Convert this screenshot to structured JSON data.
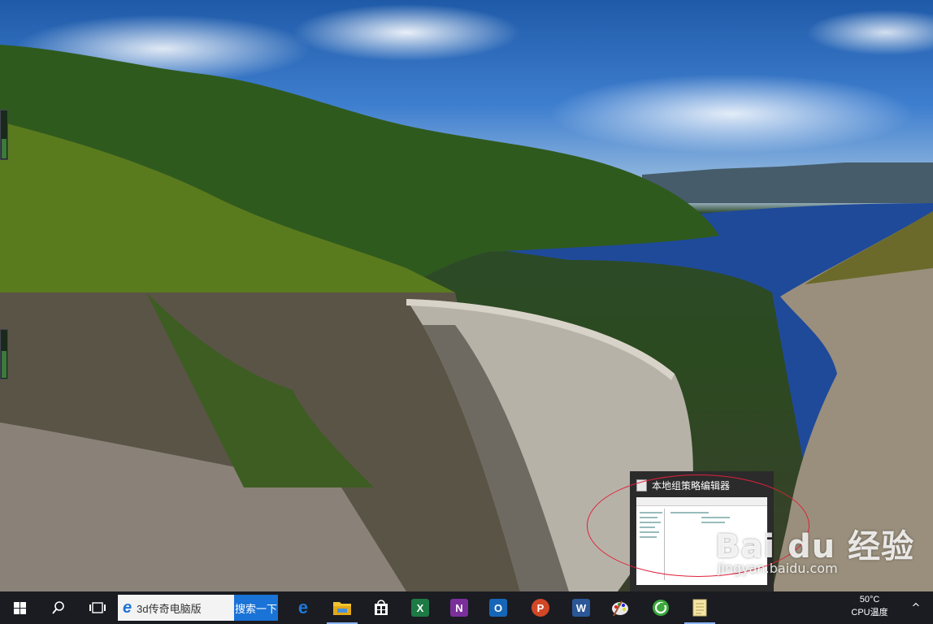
{
  "taskbar": {
    "search_box_text": "3d传奇电脑版",
    "search_button_label": "搜索一下",
    "apps": [
      {
        "name": "edge",
        "letter": "e",
        "color": "#1e78d7",
        "active": false
      },
      {
        "name": "file-explorer",
        "letter": "",
        "color": "#f2c232",
        "active": true
      },
      {
        "name": "store",
        "letter": "",
        "color": "#ffffff",
        "active": false
      },
      {
        "name": "excel",
        "letter": "X",
        "color": "#1d7a44",
        "active": false
      },
      {
        "name": "onenote",
        "letter": "N",
        "color": "#7a2f9b",
        "active": false
      },
      {
        "name": "outlook",
        "letter": "O",
        "color": "#1666b8",
        "active": false
      },
      {
        "name": "powerpoint",
        "letter": "P",
        "color": "#d24726",
        "active": false
      },
      {
        "name": "word",
        "letter": "W",
        "color": "#2b5797",
        "active": false
      },
      {
        "name": "paint",
        "letter": "",
        "color": "#e8e8e8",
        "active": false
      },
      {
        "name": "360-browser",
        "letter": "",
        "color": "#3aa83a",
        "active": false
      },
      {
        "name": "group-policy-editor",
        "letter": "",
        "color": "#f5e6a8",
        "active": true
      }
    ],
    "tray": {
      "temperature": "50°C",
      "temperature_label": "CPU温度",
      "expand": "^"
    }
  },
  "preview": {
    "title": "本地组策略编辑器"
  },
  "watermark": {
    "logo": "Bai du 经验",
    "url": "jingyan.baidu.com"
  },
  "colors": {
    "annotation": "#e0203a",
    "taskbar": "#1a1c22",
    "search_button": "#1a73d6"
  }
}
